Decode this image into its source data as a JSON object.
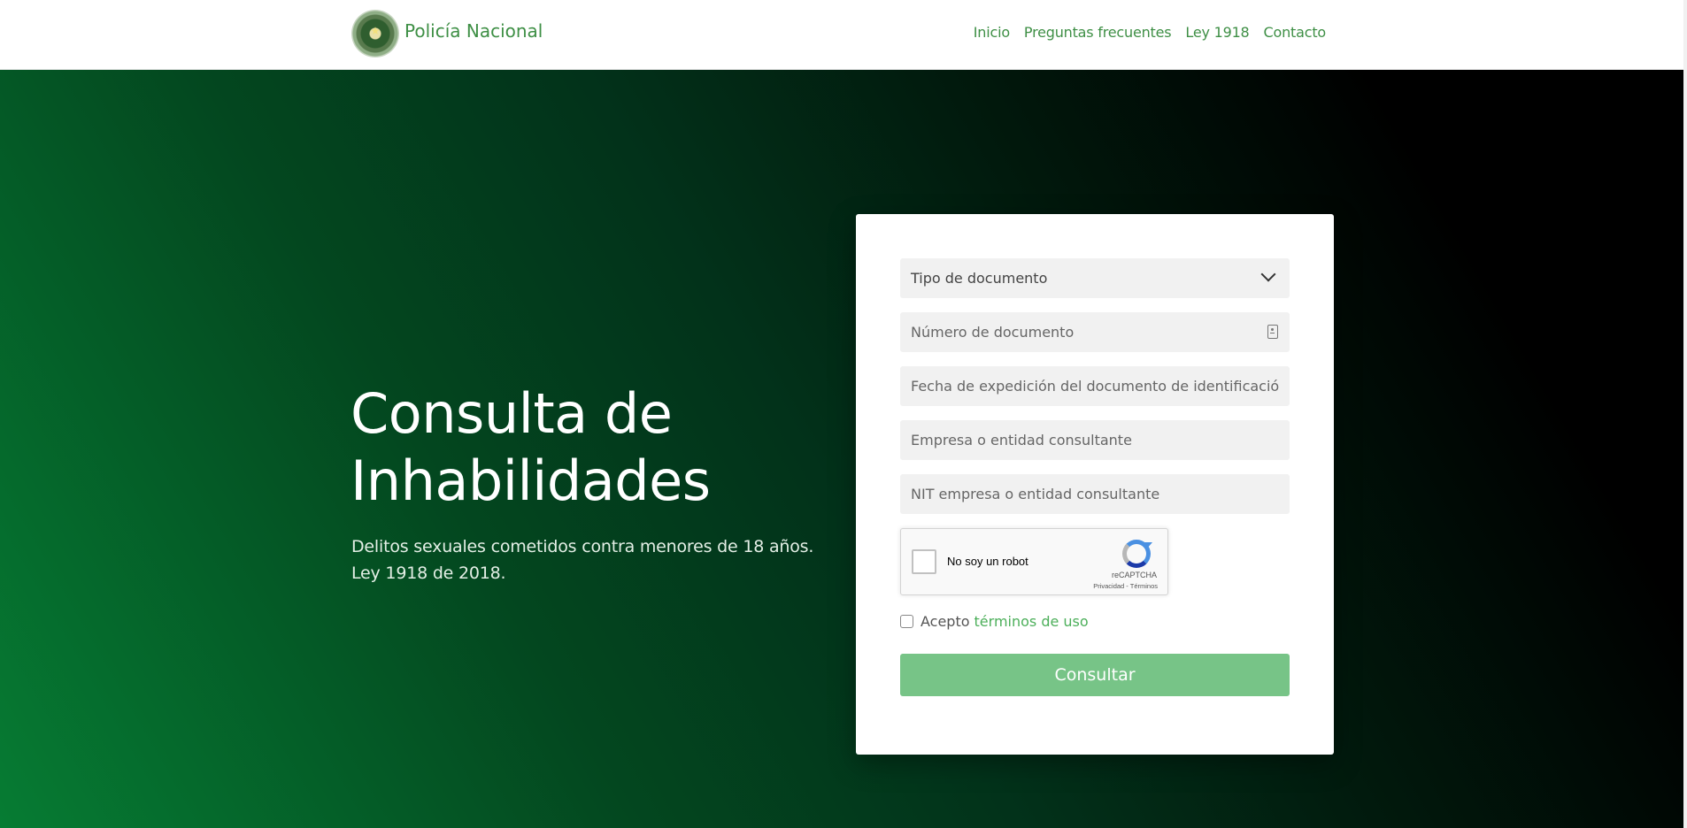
{
  "header": {
    "brand_name": "Policía Nacional",
    "nav": [
      "Inicio",
      "Preguntas frecuentes",
      "Ley 1918",
      "Contacto"
    ]
  },
  "hero": {
    "title": "Consulta de Inhabilidades",
    "subtitle_line1": "Delitos sexuales cometidos contra menores de 18 años.",
    "subtitle_line2": "Ley 1918 de 2018."
  },
  "form": {
    "document_type": {
      "label": "Tipo de documento",
      "icon": "chevron-down-icon"
    },
    "document_number": {
      "placeholder": "Número de documento",
      "value": "",
      "icon": "id-card-icon"
    },
    "issue_date": {
      "placeholder": "Fecha de expedición del documento de identificación",
      "value": ""
    },
    "company": {
      "placeholder": "Empresa o entidad consultante",
      "value": ""
    },
    "company_nit": {
      "placeholder": "NIT empresa o entidad consultante",
      "value": ""
    },
    "recaptcha": {
      "label": "No soy un robot",
      "brand": "reCAPTCHA",
      "links": "Privacidad - Términos",
      "checked": false
    },
    "terms": {
      "prefix": "Acepto",
      "link_text": "términos de uso",
      "checked": false
    },
    "submit_label": "Consultar"
  },
  "colors": {
    "brand_green": "#3e8f45",
    "button_green": "#77c487",
    "hero_gradient_start": "#067c33",
    "hero_gradient_end": "#000000"
  }
}
